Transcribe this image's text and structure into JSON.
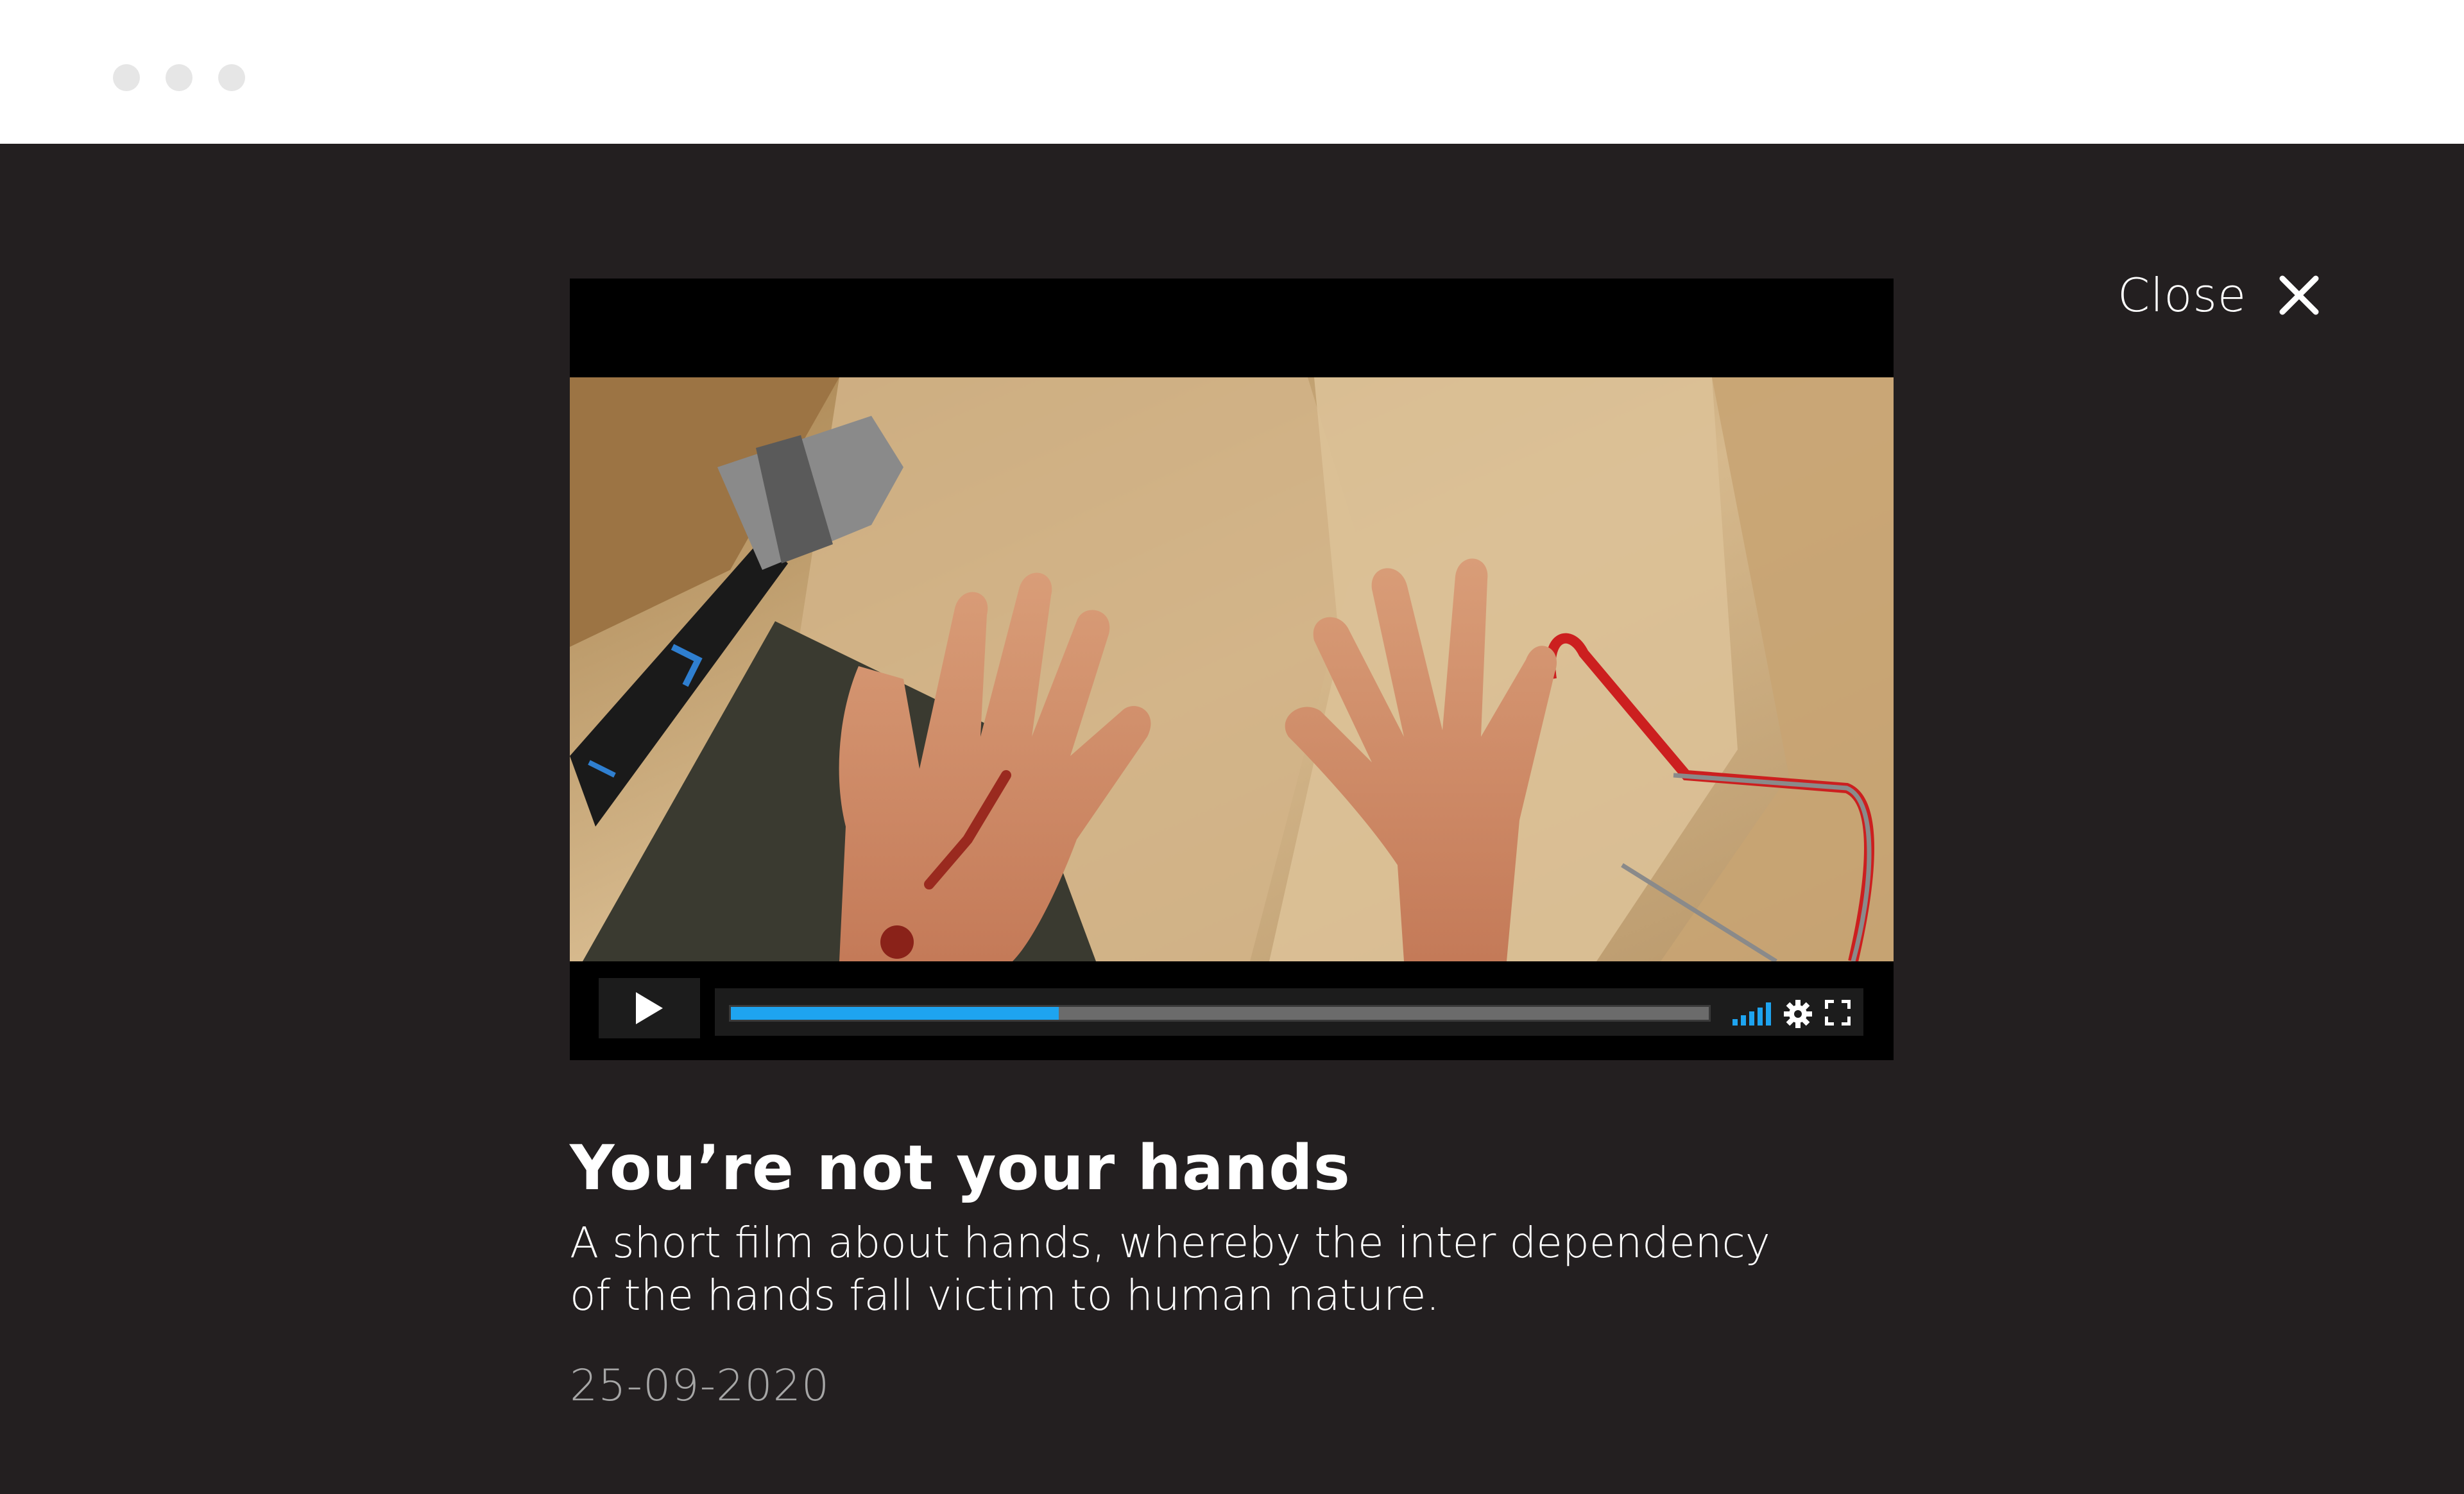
{
  "close": {
    "label": "Close"
  },
  "video": {
    "still_description": "hands-on-workbench-still",
    "progress": 0.335,
    "colors": {
      "accent": "#1ea4f0",
      "controls_bg": "#000000"
    }
  },
  "film": {
    "title": "You’re not your hands",
    "description": "A short film about hands, whereby the inter dependency of the hands fall victim to human nature.",
    "date": "25-09-2020"
  }
}
